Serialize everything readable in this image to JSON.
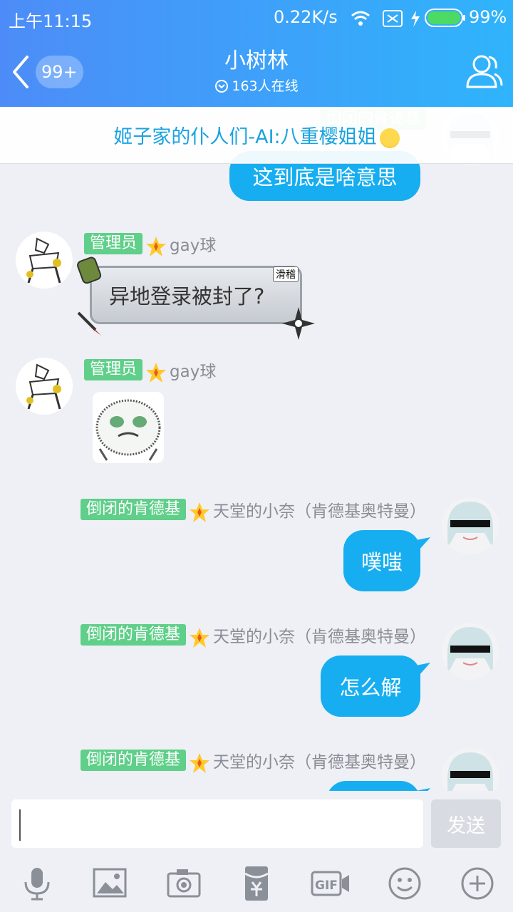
{
  "status_bar": {
    "time": "上午11:15",
    "speed": "0.22K/s",
    "battery": "99%"
  },
  "header": {
    "unread_count": "99+",
    "title": "小树林",
    "online": "163人在线"
  },
  "pinned": {
    "text": "姬子家的仆人们-AI:八重樱姐姐"
  },
  "messages": [
    {
      "side": "right",
      "text": "这到底是啥意思"
    },
    {
      "side": "left",
      "tag": "管理员",
      "name": "gay球",
      "text": "异地登录被封了?",
      "bubble_tag": "滑稽"
    },
    {
      "side": "left",
      "tag": "管理员",
      "name": "gay球",
      "type": "sticker"
    },
    {
      "side": "right",
      "tag": "倒闭的肯德基",
      "name": "天堂的小奈（肯德基奥特曼）",
      "text": "噗嗤"
    },
    {
      "side": "right",
      "tag": "倒闭的肯德基",
      "name": "天堂的小奈（肯德基奥特曼）",
      "text": "怎么解"
    },
    {
      "side": "right",
      "tag": "倒闭的肯德基",
      "name": "天堂的小奈（肯德基奥特曼）",
      "text": ""
    }
  ],
  "input": {
    "placeholder": "",
    "send_label": "发送"
  },
  "toolbar": [
    "mic-icon",
    "image-icon",
    "camera-icon",
    "red-packet-icon",
    "gif-icon",
    "emoji-icon",
    "plus-icon"
  ],
  "colors": {
    "header_start": "#4d8cf8",
    "header_end": "#2fb4fb",
    "bubble": "#16aef0",
    "role_tag": "#5fcf89",
    "pinned_text": "#1aa3e0"
  }
}
